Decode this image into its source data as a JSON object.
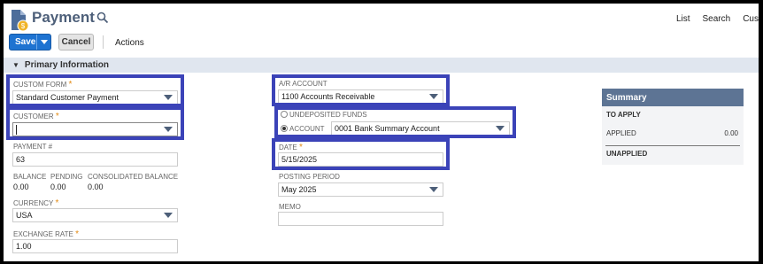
{
  "header": {
    "title": "Payment",
    "top_links": [
      "List",
      "Search",
      "Cus"
    ]
  },
  "toolbar": {
    "save_label": "Save",
    "cancel_label": "Cancel",
    "actions_label": "Actions"
  },
  "section": {
    "title": "Primary Information"
  },
  "left": {
    "custom_form": {
      "label": "CUSTOM FORM",
      "value": "Standard Customer Payment"
    },
    "customer": {
      "label": "CUSTOMER",
      "value": ""
    },
    "payment_no": {
      "label": "PAYMENT #",
      "value": "63"
    },
    "balance": {
      "label": "BALANCE",
      "value": "0.00"
    },
    "pending": {
      "label": "PENDING",
      "value": "0.00"
    },
    "consolidated_balance": {
      "label": "CONSOLIDATED BALANCE",
      "value": "0.00"
    },
    "currency": {
      "label": "CURRENCY",
      "value": "USA"
    },
    "exchange_rate": {
      "label": "EXCHANGE RATE",
      "value": "1.00"
    }
  },
  "middle": {
    "ar_account": {
      "label": "A/R ACCOUNT",
      "value": "1100 Accounts Receivable"
    },
    "undeposited_label": "UNDEPOSITED FUNDS",
    "account_label": "ACCOUNT",
    "account_value": "0001 Bank Summary Account",
    "date": {
      "label": "DATE",
      "value": "5/15/2025"
    },
    "posting_period": {
      "label": "POSTING PERIOD",
      "value": "May 2025"
    },
    "memo": {
      "label": "MEMO",
      "value": ""
    }
  },
  "summary": {
    "title": "Summary",
    "to_apply": "TO APPLY",
    "applied_label": "APPLIED",
    "applied_value": "0.00",
    "unapplied": "UNAPPLIED"
  },
  "colors": {
    "primary": "#1e73d1",
    "highlight": "#3b43b8",
    "required": "#e38b14",
    "summary_head": "#5d7494"
  }
}
